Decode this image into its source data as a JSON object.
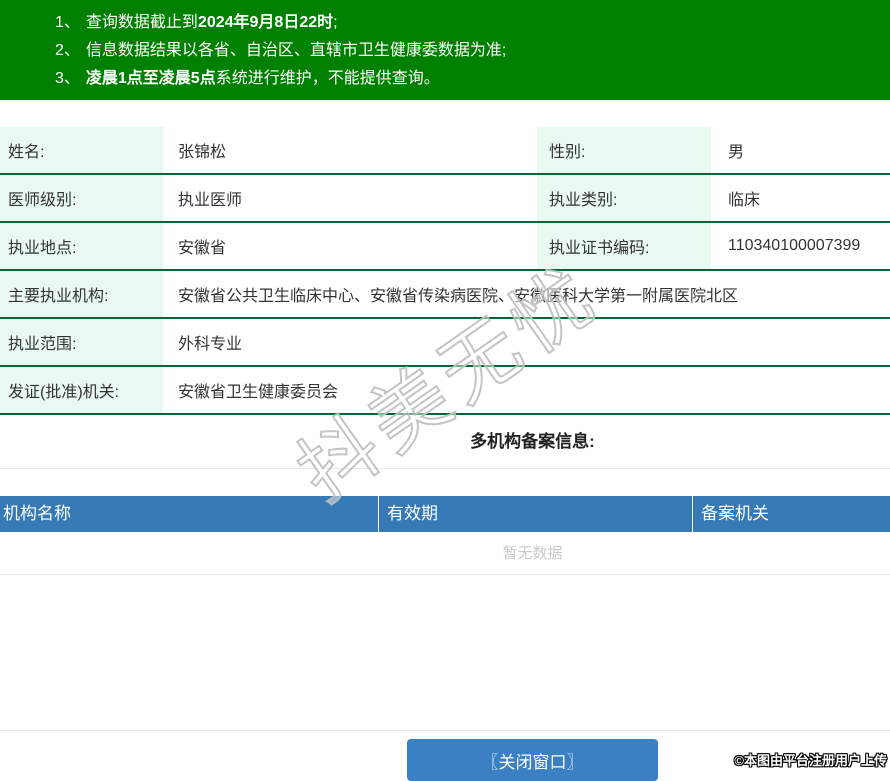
{
  "banner": {
    "notices": [
      {
        "num": "1、",
        "pre": "查询数据截止到",
        "bold": "2024年9月8日22时",
        "post": ";"
      },
      {
        "num": "2、",
        "pre": "信息数据结果以各省、自治区、直辖市卫生健康委数据为准;",
        "bold": "",
        "post": ""
      },
      {
        "num": "3、",
        "pre": "",
        "bold": "凌晨1点至凌晨5点",
        "post": "系统进行维护，不能提供查询。"
      }
    ]
  },
  "doctor": {
    "name_label": "姓名:",
    "name_value": "张锦松",
    "gender_label": "性别:",
    "gender_value": "男",
    "level_label": "医师级别:",
    "level_value": "执业医师",
    "category_label": "执业类别:",
    "category_value": "临床",
    "location_label": "执业地点:",
    "location_value": "安徽省",
    "cert_label": "执业证书编码:",
    "cert_value": "110340100007399",
    "main_org_label": "主要执业机构:",
    "main_org_value": "安徽省公共卫生临床中心、安徽省传染病医院、安徽医科大学第一附属医院北区",
    "scope_label": "执业范围:",
    "scope_value": "外科专业",
    "issuer_label": "发证(批准)机关:",
    "issuer_value": "安徽省卫生健康委员会"
  },
  "filing": {
    "heading": "多机构备案信息:",
    "columns": [
      "机构名称",
      "有效期",
      "备案机关"
    ],
    "empty_text": "暂无数据"
  },
  "footer": {
    "close_button": "〖关闭窗口〗"
  },
  "watermarks": {
    "diagonal": "抖美无忧",
    "corner": "©本图由平台注册用户上传"
  },
  "colors": {
    "banner_green": "#008000",
    "border_green": "#006633",
    "label_mint": "#e9f9f0",
    "header_blue": "#3579b5",
    "button_blue": "#3b80c3"
  }
}
